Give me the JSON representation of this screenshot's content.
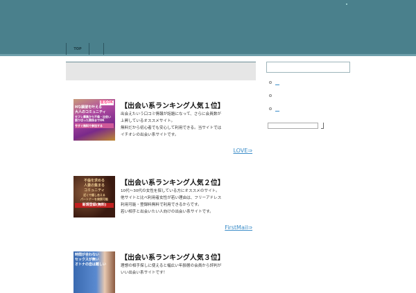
{
  "nav": {
    "items": [
      {
        "label": "TOP"
      },
      {
        "label": ""
      }
    ]
  },
  "entries": [
    {
      "title": "【出会い系ランキング人気１位】",
      "desc": [
        "出会えたいう口コミ情報が話題になって、さらに会員数が",
        "上昇しているオススメサイト。",
        "無料だから初心者でも安心して利用できる。当サイトでは",
        "イチオシの出会い系サイトです。"
      ],
      "link": "LOVE⇒",
      "banner": [
        "匿名OK",
        "Hな願望を叶える",
        "大人のコミュニティ",
        "セフレ募集から不倫・出会い",
        "割り切った関係までOK",
        "今すぐ無料で参加する"
      ]
    },
    {
      "title": "【出会い系ランキング人気２位】",
      "desc": [
        "10代～30代の女性を探している方にオススメのサイト。",
        "他サイトと比べ利用者女性が若い理由は、フリーアドレス",
        "利用可能・登録料無料で利用できるからです。",
        "若い相手と出会いたい人向けの出会い系サイトです。"
      ],
      "link": "FirstMail⇒",
      "banner": [
        "不倫を求める",
        "人妻の集まる",
        "コミュニティ",
        "近くで癒し合える",
        "パートナーを検索可能",
        "新規登録(無料)"
      ]
    },
    {
      "title": "【出会い系ランキング人気３位】",
      "desc": [
        "理想の相手探しに使えると幅広い年齢層の会員から評判が",
        "いい出会い系サイトです！"
      ],
      "link": "",
      "banner": [
        "時間が合わない",
        "セックスが無い",
        "オトナの恋は難しい"
      ]
    }
  ],
  "sidebar": {
    "links": [
      "__",
      "",
      "__"
    ]
  },
  "colors": {
    "header": "#4a808c",
    "link": "#3a8cc8"
  }
}
